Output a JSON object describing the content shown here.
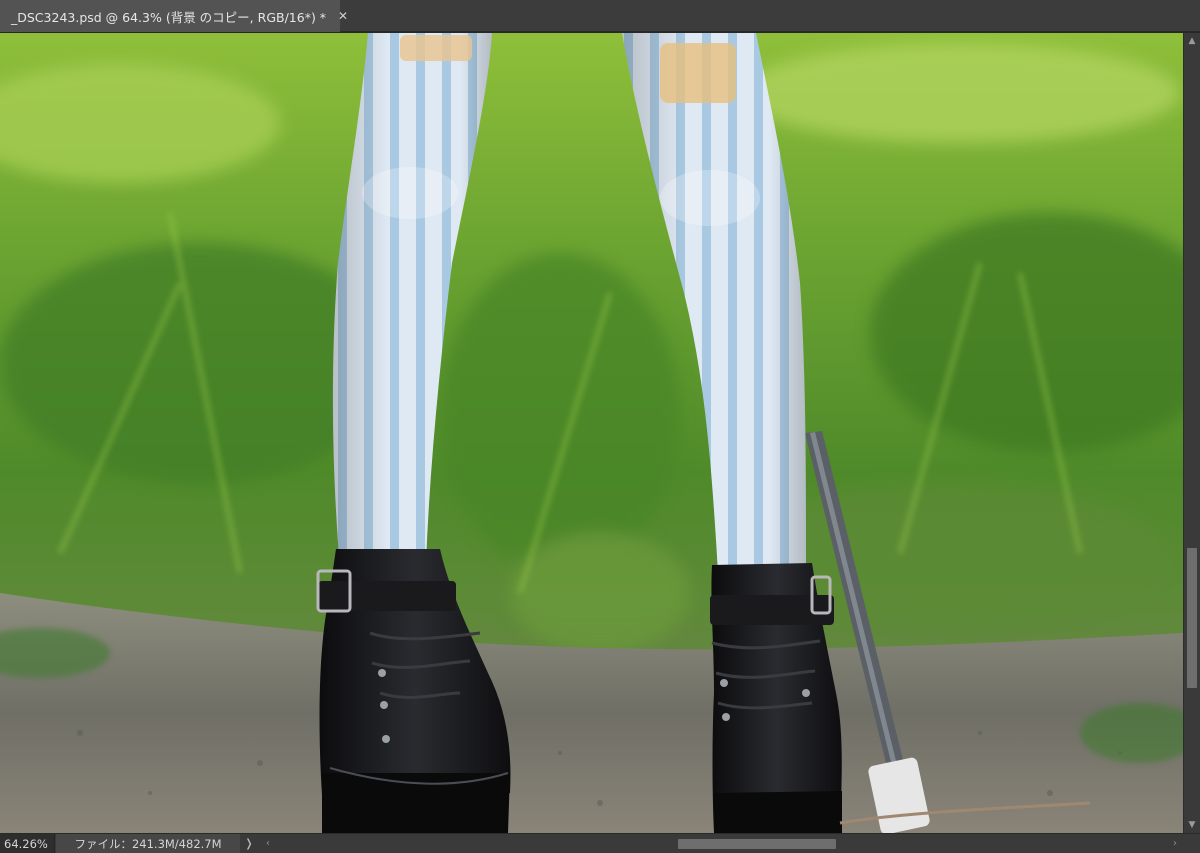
{
  "document_tab": {
    "title": "_DSC3243.psd @ 64.3% (背景 のコピー, RGB/16*) *",
    "close_glyph": "✕"
  },
  "canvas": {
    "image_subject": "photo-canvas"
  },
  "status_bar": {
    "zoom": "64.26%",
    "file_info": "ファイル：241.3M/482.7M",
    "menu_glyph": "❭"
  },
  "scrollbars": {
    "up_glyph": "▲",
    "down_glyph": "▼",
    "left_glyph": "‹",
    "right_glyph": "›"
  },
  "colors": {
    "tab_active": "#535353",
    "tabbar": "#3c3c3c",
    "statusbar": "#3a3a3a"
  }
}
